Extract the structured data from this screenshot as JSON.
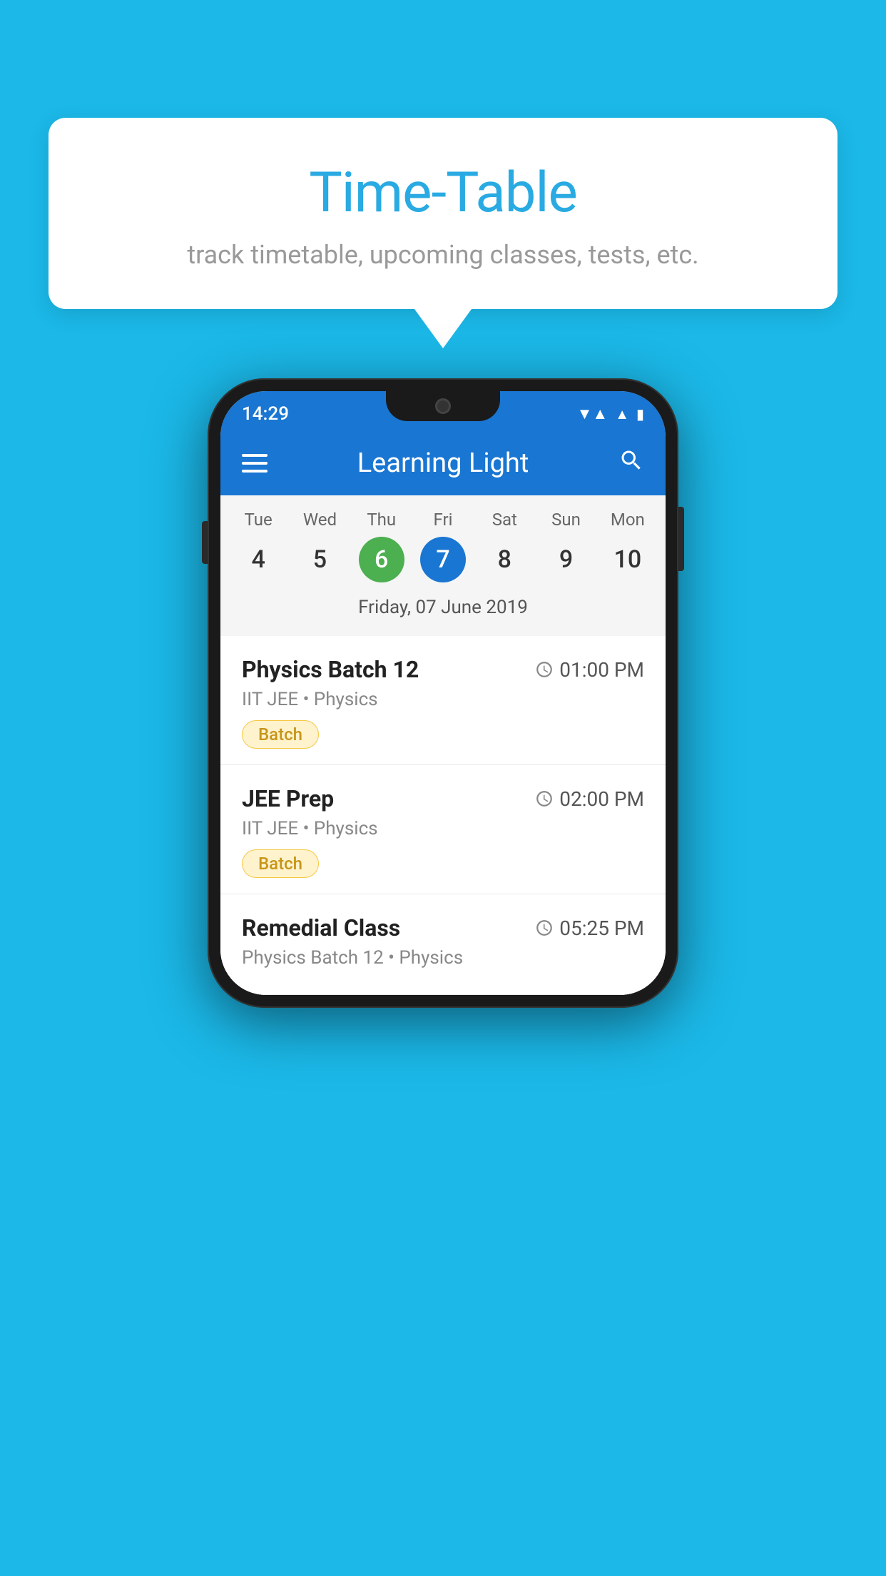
{
  "background_color": "#1BB8E8",
  "speech_bubble": {
    "title": "Time-Table",
    "subtitle": "track timetable, upcoming classes, tests, etc."
  },
  "phone": {
    "status_bar": {
      "time": "14:29"
    },
    "app_bar": {
      "title": "Learning Light"
    },
    "calendar": {
      "days": [
        {
          "name": "Tue",
          "number": "4",
          "state": "normal"
        },
        {
          "name": "Wed",
          "number": "5",
          "state": "normal"
        },
        {
          "name": "Thu",
          "number": "6",
          "state": "today"
        },
        {
          "name": "Fri",
          "number": "7",
          "state": "selected"
        },
        {
          "name": "Sat",
          "number": "8",
          "state": "normal"
        },
        {
          "name": "Sun",
          "number": "9",
          "state": "normal"
        },
        {
          "name": "Mon",
          "number": "10",
          "state": "normal"
        }
      ],
      "selected_date_label": "Friday, 07 June 2019"
    },
    "schedule_items": [
      {
        "title": "Physics Batch 12",
        "time": "01:00 PM",
        "subtitle": "IIT JEE • Physics",
        "badge": "Batch"
      },
      {
        "title": "JEE Prep",
        "time": "02:00 PM",
        "subtitle": "IIT JEE • Physics",
        "badge": "Batch"
      },
      {
        "title": "Remedial Class",
        "time": "05:25 PM",
        "subtitle": "Physics Batch 12 • Physics",
        "badge": null
      }
    ]
  }
}
